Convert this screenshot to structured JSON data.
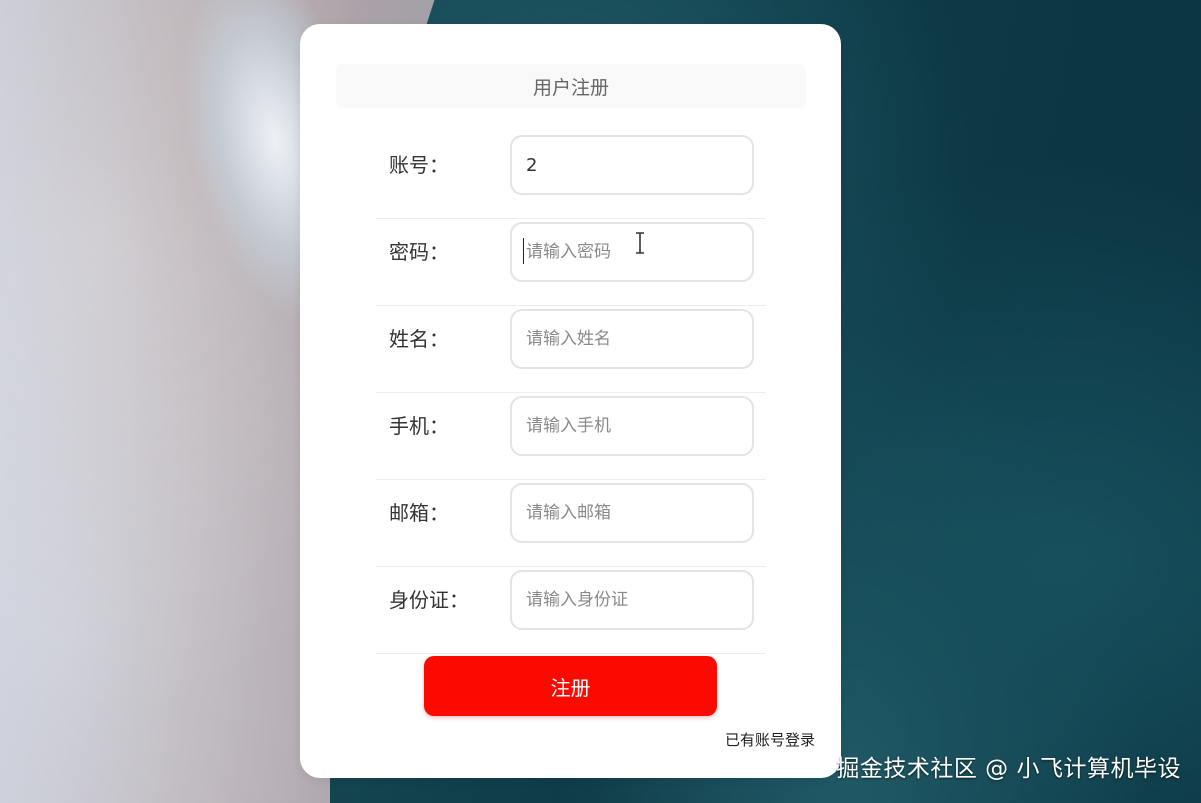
{
  "form": {
    "title": "用户注册",
    "fields": [
      {
        "label": "账号：",
        "value": "2",
        "placeholder": ""
      },
      {
        "label": "密码：",
        "value": "",
        "placeholder": "请输入密码"
      },
      {
        "label": "姓名：",
        "value": "",
        "placeholder": "请输入姓名"
      },
      {
        "label": "手机：",
        "value": "",
        "placeholder": "请输入手机"
      },
      {
        "label": "邮箱：",
        "value": "",
        "placeholder": "请输入邮箱"
      },
      {
        "label": "身份证：",
        "value": "",
        "placeholder": "请输入身份证"
      }
    ],
    "submit_label": "注册",
    "login_link": "已有账号登录"
  },
  "watermark": "掘金技术社区 @ 小飞计算机毕设",
  "colors": {
    "primary_button": "#fa0a00",
    "card_background": "#ffffff"
  }
}
